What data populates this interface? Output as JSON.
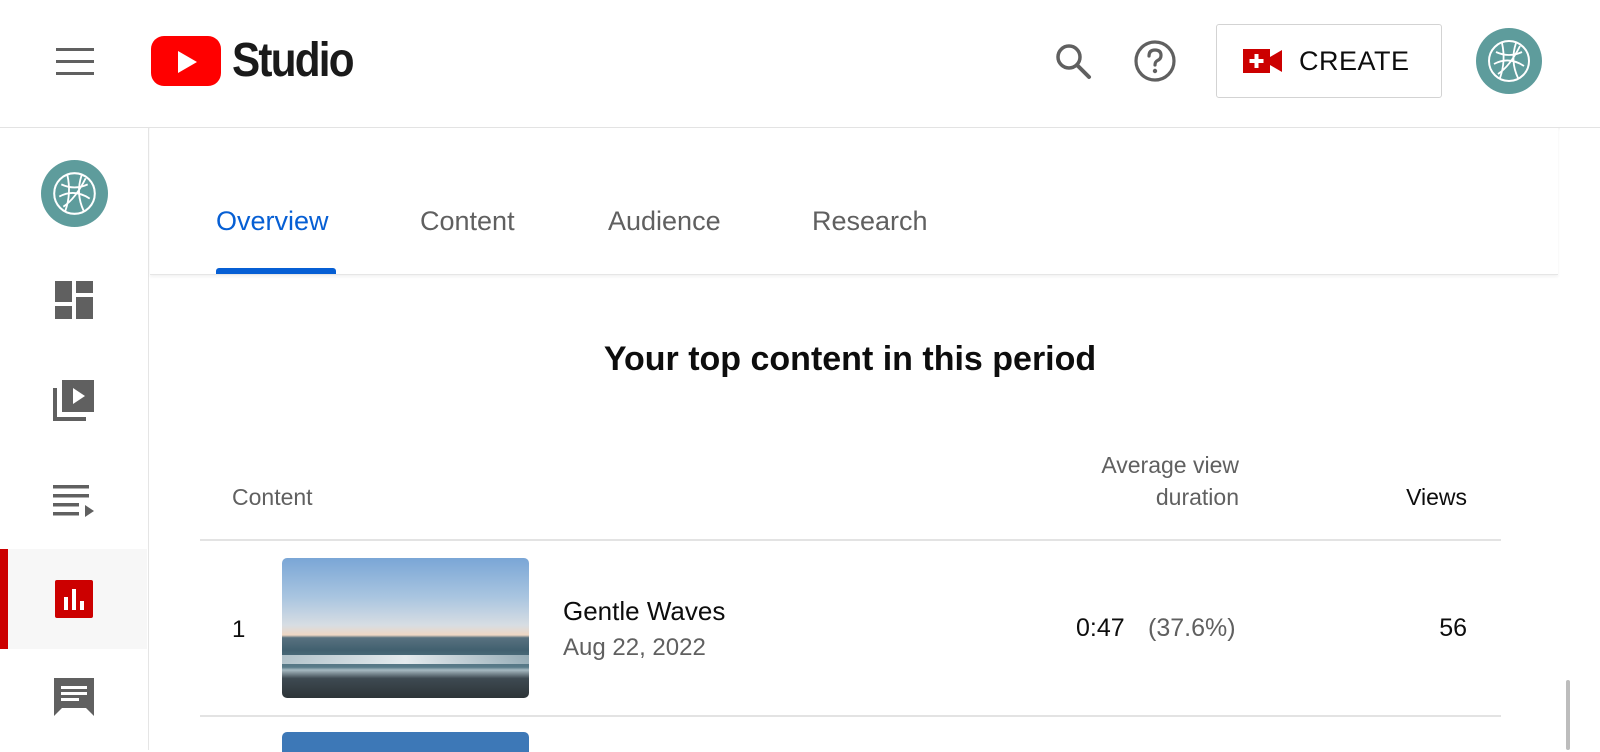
{
  "header": {
    "logo_text": "Studio",
    "create_label": "CREATE",
    "icons": {
      "menu": "hamburger-menu-icon",
      "search": "search-icon",
      "help": "help-icon",
      "create": "video-camera-plus-icon",
      "avatar": "channel-avatar"
    }
  },
  "sidebar": {
    "items": [
      {
        "icon": "dashboard-icon",
        "active": false
      },
      {
        "icon": "content-icon",
        "active": false
      },
      {
        "icon": "playlists-icon",
        "active": false
      },
      {
        "icon": "analytics-icon",
        "active": true
      },
      {
        "icon": "comments-icon",
        "active": false
      }
    ]
  },
  "tabs": [
    {
      "label": "Overview",
      "active": true
    },
    {
      "label": "Content",
      "active": false
    },
    {
      "label": "Audience",
      "active": false
    },
    {
      "label": "Research",
      "active": false
    }
  ],
  "section": {
    "title": "Your top content in this period"
  },
  "table": {
    "headers": {
      "content": "Content",
      "avd_line1": "Average view",
      "avd_line2": "duration",
      "views": "Views"
    },
    "rows": [
      {
        "rank": "1",
        "title": "Gentle Waves",
        "date": "Aug 22, 2022",
        "avd": "0:47",
        "avd_pct": "(37.6%)",
        "views": "56"
      }
    ]
  },
  "colors": {
    "brand_red": "#ff0000",
    "active_red": "#cc0000",
    "tab_blue": "#065fd4",
    "avatar_teal": "#5e9c9c"
  }
}
